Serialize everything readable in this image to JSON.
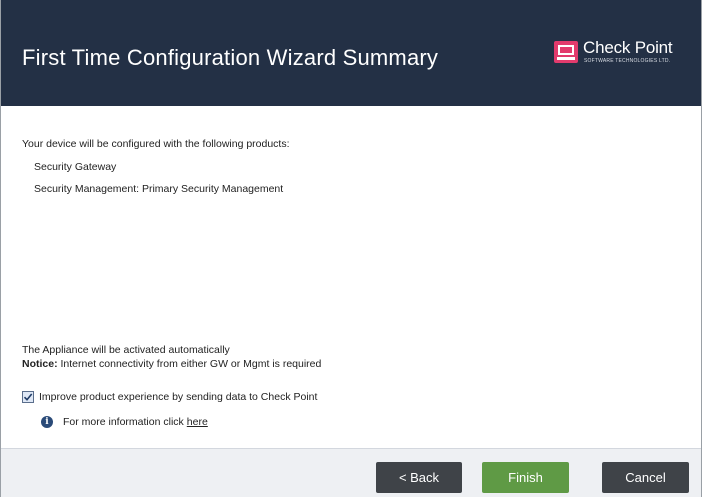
{
  "header": {
    "title": "First Time Configuration Wizard Summary",
    "logo_name": "Check Point",
    "logo_tagline": "SOFTWARE TECHNOLOGIES LTD."
  },
  "content": {
    "intro": "Your device will be configured with the following products:",
    "products": [
      "Security Gateway",
      "Security Management: Primary Security Management"
    ],
    "activation": "The Appliance will be activated automatically",
    "notice_label": "Notice:",
    "notice_text": " Internet connectivity from either GW or Mgmt is required",
    "improve_label": "Improve product experience by sending data to Check Point",
    "improve_checked": true,
    "moreinfo_text": "For more information click",
    "moreinfo_link": "here"
  },
  "footer": {
    "back_label": "< Back",
    "finish_label": "Finish",
    "cancel_label": "Cancel"
  },
  "colors": {
    "header_bg": "#233045",
    "finish_bg": "#5f9a45",
    "button_bg": "#3f4348"
  }
}
